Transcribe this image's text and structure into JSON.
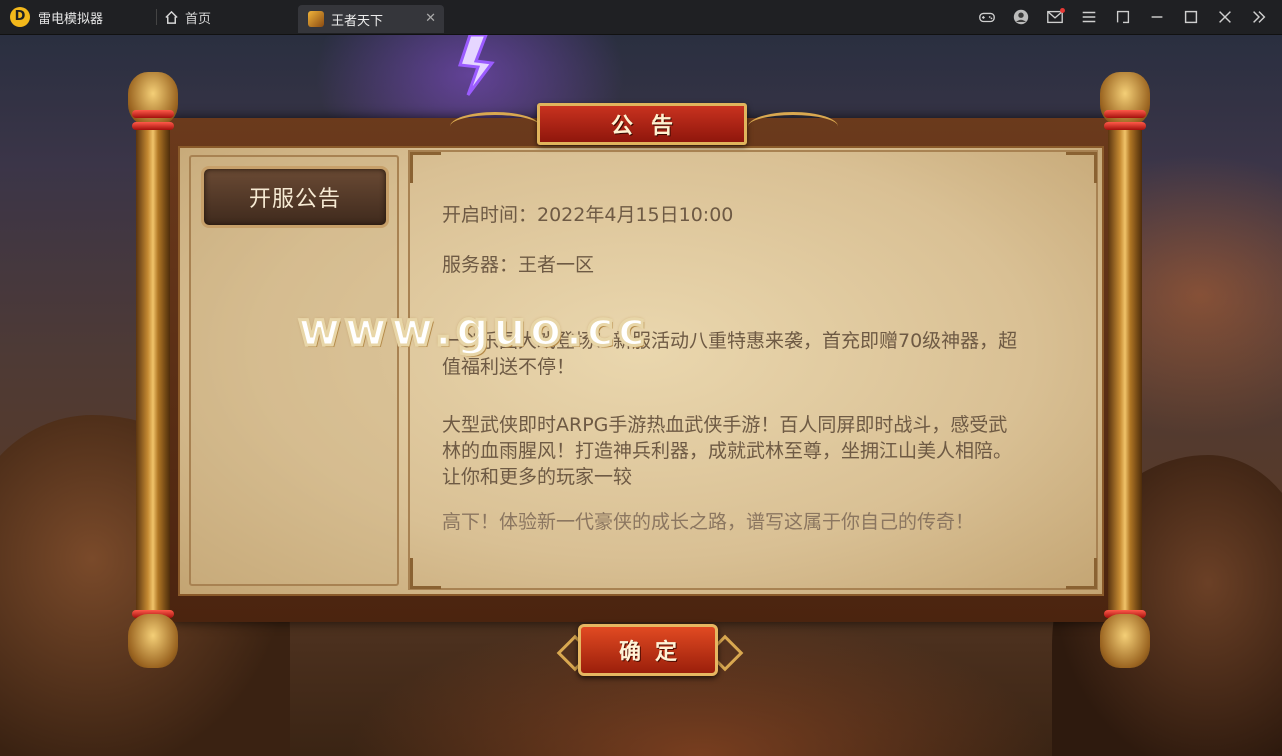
{
  "app": {
    "name": "雷电模拟器",
    "logo_glyph": "D",
    "accent": "#f3b81b"
  },
  "tabs": {
    "home_label": "首页",
    "game_label": "王者天下",
    "close_glyph": "✕"
  },
  "toolbar_icons": [
    "gamepad-icon",
    "user-icon",
    "mail-icon",
    "menu-icon",
    "resize-icon",
    "minimize-icon",
    "maximize-icon",
    "close-icon",
    "collapse-sidebar-icon"
  ],
  "dialog": {
    "title": "公告",
    "tab_label": "开服公告",
    "line_time": "开启时间：2022年4月15日10:00",
    "line_server": "服务器：王者一区",
    "para_event": "一剑乐园大戏登场！新服活动八重特惠来袭，首充即赠70级神器，超值福利送不停！",
    "para_intro": "大型武侠即时ARPG手游热血武侠手游！百人同屏即时战斗，感受武林的血雨腥风！打造神兵利器，成就武林至尊，坐拥江山美人相陪。让你和更多的玩家一较",
    "para_more": "高下！体验新一代豪侠的成长之路，谱写这属于你自己的传奇！",
    "confirm_label": "确定"
  },
  "watermark": "www.guo.cc"
}
